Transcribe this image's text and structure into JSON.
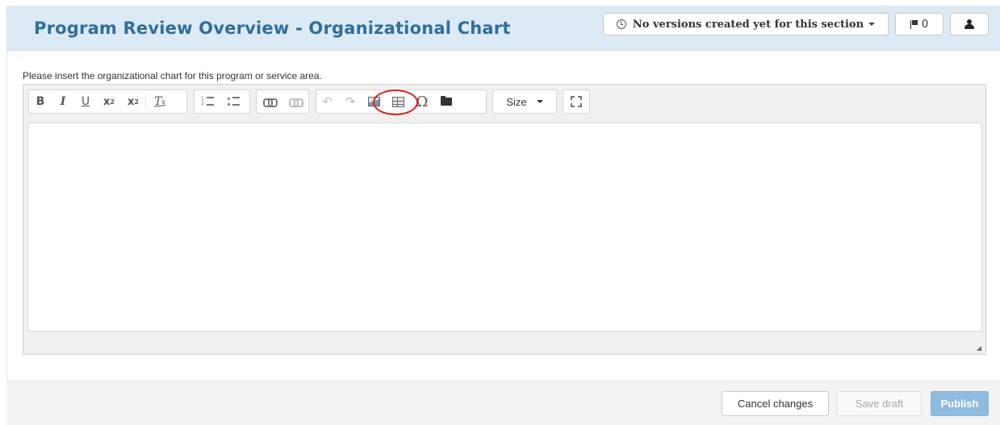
{
  "header": {
    "title": "Program Review Overview - Organizational Chart",
    "versions_label": "No versions created yet for this section",
    "flag_count": "0"
  },
  "form": {
    "instruction": "Please insert the organizational chart for this program or service area."
  },
  "toolbar": {
    "bold": "B",
    "italic": "I",
    "underline": "U",
    "subscript": "x",
    "subscript_mark": "2",
    "superscript": "x",
    "superscript_mark": "2",
    "remove_format": "T",
    "remove_format_mark": "x",
    "omega": "Ω",
    "size_label": "Size",
    "undo": "↶",
    "redo": "↷",
    "highlighted_button": "image-button"
  },
  "actions": {
    "cancel": "Cancel changes",
    "save_draft": "Save draft",
    "publish": "Publish"
  },
  "colors": {
    "header_bg": "#dceaf5",
    "title": "#2f6f99",
    "publish_bg": "#8fbcde",
    "highlight_ring": "#e0201e"
  }
}
